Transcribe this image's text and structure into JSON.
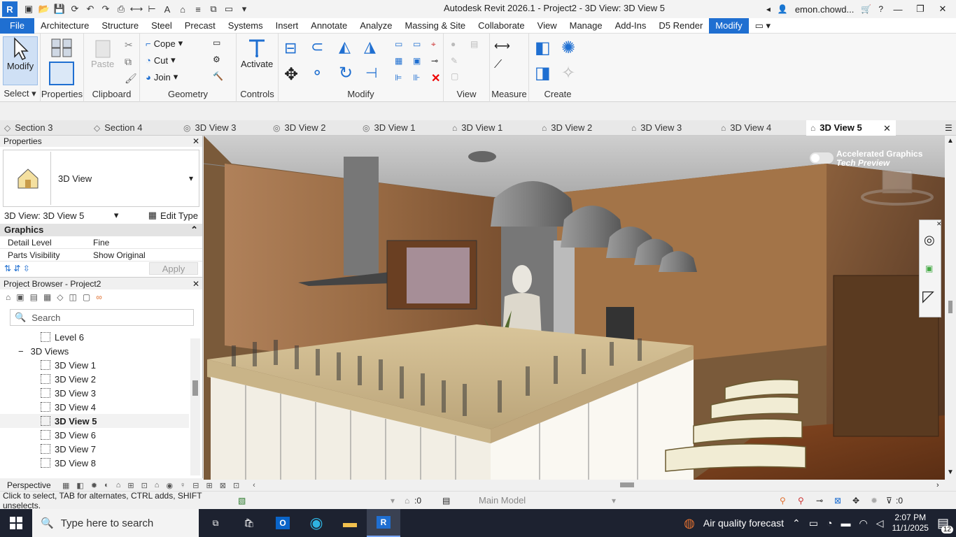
{
  "window": {
    "title": "Autodesk Revit 2026.1 - Project2 - 3D View: 3D View 5",
    "user": "emon.chowd...",
    "app_letter": "R"
  },
  "ribbon_tabs": [
    "File",
    "Architecture",
    "Structure",
    "Steel",
    "Precast",
    "Systems",
    "Insert",
    "Annotate",
    "Analyze",
    "Massing & Site",
    "Collaborate",
    "View",
    "Manage",
    "Add-Ins",
    "D5 Render",
    "Modify"
  ],
  "active_tab_index": 15,
  "ribbon": {
    "modify_label": "Modify",
    "select_label": "Select",
    "properties_label": "Properties",
    "paste_label": "Paste",
    "clipboard_label": "Clipboard",
    "cope_label": "Cope",
    "cut_label": "Cut",
    "join_label": "Join",
    "geometry_label": "Geometry",
    "activate_label": "Activate",
    "controls_label": "Controls",
    "modify_panel_label": "Modify",
    "view_label": "View",
    "measure_label": "Measure",
    "create_label": "Create"
  },
  "view_tabs": [
    {
      "label": "Section 3",
      "icon": "section-icon"
    },
    {
      "label": "Section 4",
      "icon": "section-icon"
    },
    {
      "label": "3D View 3",
      "icon": "3d-view-icon"
    },
    {
      "label": "3D View 2",
      "icon": "3d-view-icon"
    },
    {
      "label": "3D View 1",
      "icon": "3d-view-icon"
    },
    {
      "label": "3D View 1",
      "icon": "home-3d-icon"
    },
    {
      "label": "3D View 2",
      "icon": "home-3d-icon"
    },
    {
      "label": "3D View 3",
      "icon": "home-3d-icon"
    },
    {
      "label": "3D View 4",
      "icon": "home-3d-icon"
    },
    {
      "label": "3D View 5",
      "icon": "home-3d-icon",
      "active": true
    }
  ],
  "properties": {
    "title": "Properties",
    "type_name": "3D View",
    "selector": "3D View: 3D View 5",
    "edit_type": "Edit Type",
    "group": "Graphics",
    "rows": [
      {
        "key": "Detail Level",
        "value": "Fine"
      },
      {
        "key": "Parts Visibility",
        "value": "Show Original"
      }
    ],
    "apply": "Apply"
  },
  "project_browser": {
    "title": "Project Browser - Project2",
    "search_placeholder": "Search",
    "items": [
      {
        "label": "Level 6",
        "type": "view",
        "indent": 2
      },
      {
        "label": "3D Views",
        "type": "group",
        "indent": 1
      },
      {
        "label": "3D View 1",
        "type": "view",
        "indent": 2
      },
      {
        "label": "3D View 2",
        "type": "view",
        "indent": 2
      },
      {
        "label": "3D View 3",
        "type": "view",
        "indent": 2
      },
      {
        "label": "3D View 4",
        "type": "view",
        "indent": 2
      },
      {
        "label": "3D View 5",
        "type": "view",
        "indent": 2,
        "selected": true
      },
      {
        "label": "3D View 6",
        "type": "view",
        "indent": 2
      },
      {
        "label": "3D View 7",
        "type": "view",
        "indent": 2
      },
      {
        "label": "3D View 8",
        "type": "view",
        "indent": 2
      }
    ]
  },
  "viewport": {
    "badge_line1": "Accelerated Graphics",
    "badge_line2": "Tech Preview"
  },
  "view_control_bar": {
    "projection": "Perspective"
  },
  "status": {
    "hint": "Click to select, TAB for alternates, CTRL adds, SHIFT unselects.",
    "workset_count": ":0",
    "model": "Main Model",
    "filter_count": ":0"
  },
  "taskbar": {
    "search_placeholder": "Type here to search",
    "weather": "Air quality forecast",
    "time": "2:07 PM",
    "date": "11/1/2025",
    "notifications": "12"
  },
  "colors": {
    "accent": "#1f6fd1",
    "taskbar": "#1d2230"
  }
}
